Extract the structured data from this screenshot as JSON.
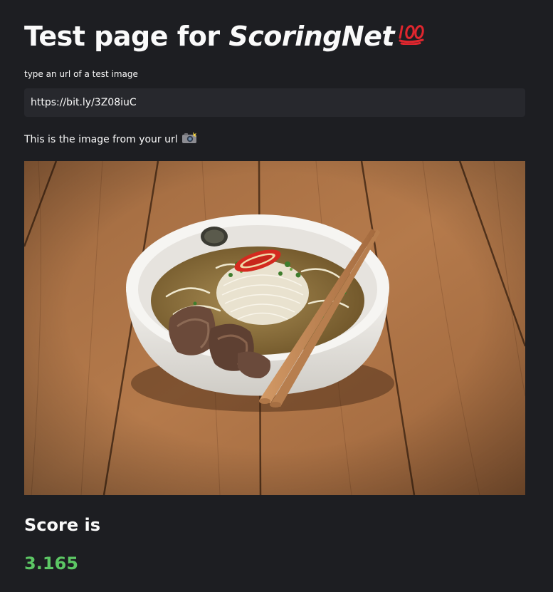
{
  "header": {
    "title_prefix": "Test page for ",
    "title_emphasis": "ScoringNet",
    "title_emoji": "hundred-points-icon"
  },
  "form": {
    "label": "type an url of a test image",
    "url_value": "https://bit.ly/3Z08iuC"
  },
  "preview": {
    "caption": "This is the image from your url",
    "caption_emoji": "camera-flash-icon",
    "image_subject": "noodle-soup-bowl-photo"
  },
  "result": {
    "heading": "Score is",
    "score": "3.165"
  },
  "colors": {
    "background": "#1d1e22",
    "input_background": "#27282d",
    "score_green": "#5cc664",
    "emoji_red": "#e0262e"
  }
}
